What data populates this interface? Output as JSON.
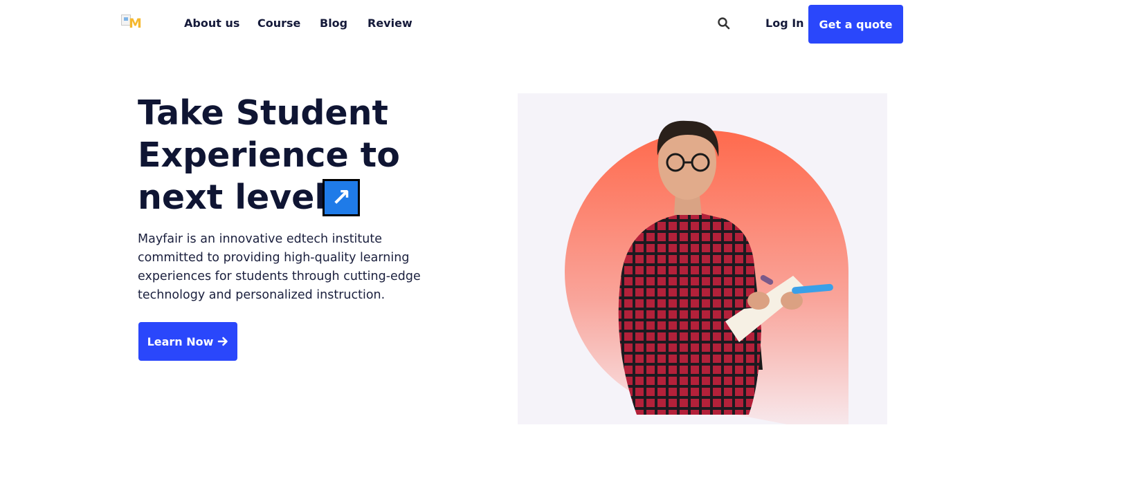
{
  "header": {
    "logo_alt": "M",
    "nav": [
      "About us",
      "Course",
      "Blog",
      "Review"
    ],
    "search_icon": "search-icon",
    "login_label": "Log In",
    "cta_label": "Get a quote"
  },
  "hero": {
    "headline_line1": "Take Student",
    "headline_line2": "Experience to",
    "headline_line3": "next level",
    "arrow_glyph": "↗",
    "description": "Mayfair is an innovative edtech institute committed to providing high-quality learning experiences for students through cutting-edge technology and personalized instruction.",
    "learn_label": "Learn Now",
    "learn_icon": "arrow-right-icon"
  },
  "colors": {
    "primary": "#2a47fb",
    "text": "#0f1533",
    "logo": "#f5b82e",
    "gradient_top": "#ff6a4d",
    "gradient_bottom": "#f7eef3",
    "shirt": "#c0203a"
  }
}
